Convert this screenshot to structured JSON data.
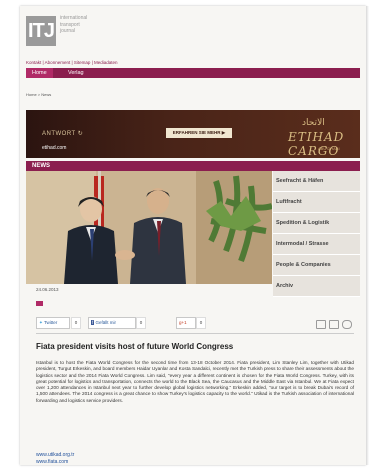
{
  "logo": {
    "letters": "ITJ",
    "line1": "international",
    "line2": "transport",
    "line3": "journal"
  },
  "top_links": "Kontakt | Abonnement | Sitemap | Mediadaten",
  "nav": {
    "home": "Home",
    "verlag": "Verlag"
  },
  "breadcrumb": "Home > News",
  "ad": {
    "antwort": "ANTWORT ↻",
    "url": "etihad.com",
    "button": "ERFAHREN SIE MEHR ▶",
    "brand_arabic": "الاتحاد",
    "brand": "ETIHAD",
    "brand_sub": "CARGO",
    "brand_tagline": "ABU DHABI"
  },
  "news_label": "NEWS",
  "sidebar": [
    {
      "label": "Seefracht & Häfen"
    },
    {
      "label": "Luftfracht"
    },
    {
      "label": "Spedition & Logistik"
    },
    {
      "label": "Intermodal / Strasse"
    },
    {
      "label": "People & Companies"
    },
    {
      "label": "Archiv"
    }
  ],
  "article": {
    "date": "24.06.2013",
    "share_twitter": "Twitter",
    "share_twitter_count": "0",
    "share_facebook": "Gefällt mir",
    "share_facebook_count": "0",
    "share_gplus": "g+1",
    "share_gplus_count": "0",
    "headline": "Fiata president visits host of future World Congress",
    "body": "Istanbul is to host the Fiata World Congress for the second time from 13-18 October 2014. Fiata president, Lim Stanley Lim, together with Utikad president, Turgut Erkeskin, and board members Haidar Uyanlar and Kosta Sandalci, recently met the Turkish press to share their assessments about the logistics sector and the 2014 Fiata World Congress. Lim said, \"every year a different continent is chosen for the Fiata World Congress. Turkey, with its great potential for logistics and transportation, connects the world to the Black Sea, the Caucasus and the Middle East via Istanbul. We at Fiata expect over 1,200 attendances in Istanbul next year to further develop global logistics networking.\" Erkeskin added, \"our target is to break Dubai's record of 1,500 attendees. The 2014 congress is a great chance to show Turkey's logistics capacity to the world.\" Utikad is the Turkish association of international forwarding and logistics service providers.",
    "link1": "www.utikad.org.tr",
    "link2": "www.fiata.com"
  }
}
